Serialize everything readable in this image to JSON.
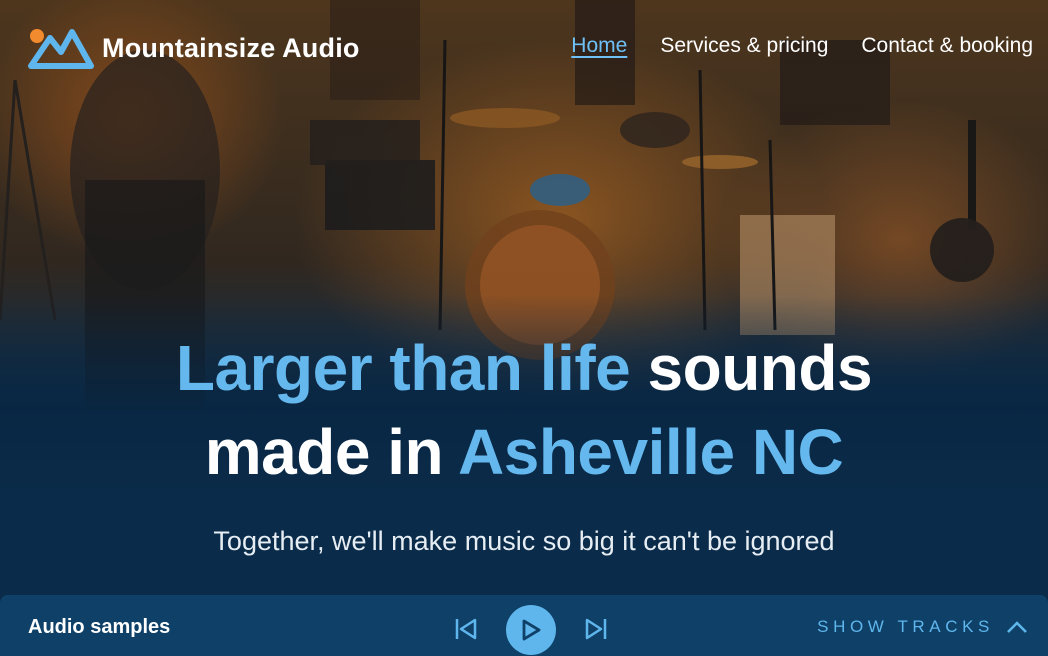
{
  "brand": {
    "name": "Mountainsize Audio",
    "logo_icon": "mountain-logo-icon",
    "accent_color": "#65b8ee",
    "sun_color": "#f28a2e"
  },
  "nav": {
    "items": [
      {
        "label": "Home",
        "active": true
      },
      {
        "label": "Services & pricing",
        "active": false
      },
      {
        "label": "Contact & booking",
        "active": false
      }
    ]
  },
  "hero": {
    "headline_part1": "Larger than life",
    "headline_part2": " sounds",
    "headline_part3": "made in ",
    "headline_part4": "Asheville NC",
    "subheadline": "Together, we'll make music so big it can't be ignored",
    "background_image": "recording studio drum kit photo"
  },
  "player": {
    "title": "Audio samples",
    "prev_icon": "skip-previous-icon",
    "play_icon": "play-icon",
    "next_icon": "skip-next-icon",
    "show_tracks_label": "SHOW TRACKS",
    "expand_icon": "chevron-up-icon",
    "bar_color": "#0e4068"
  }
}
